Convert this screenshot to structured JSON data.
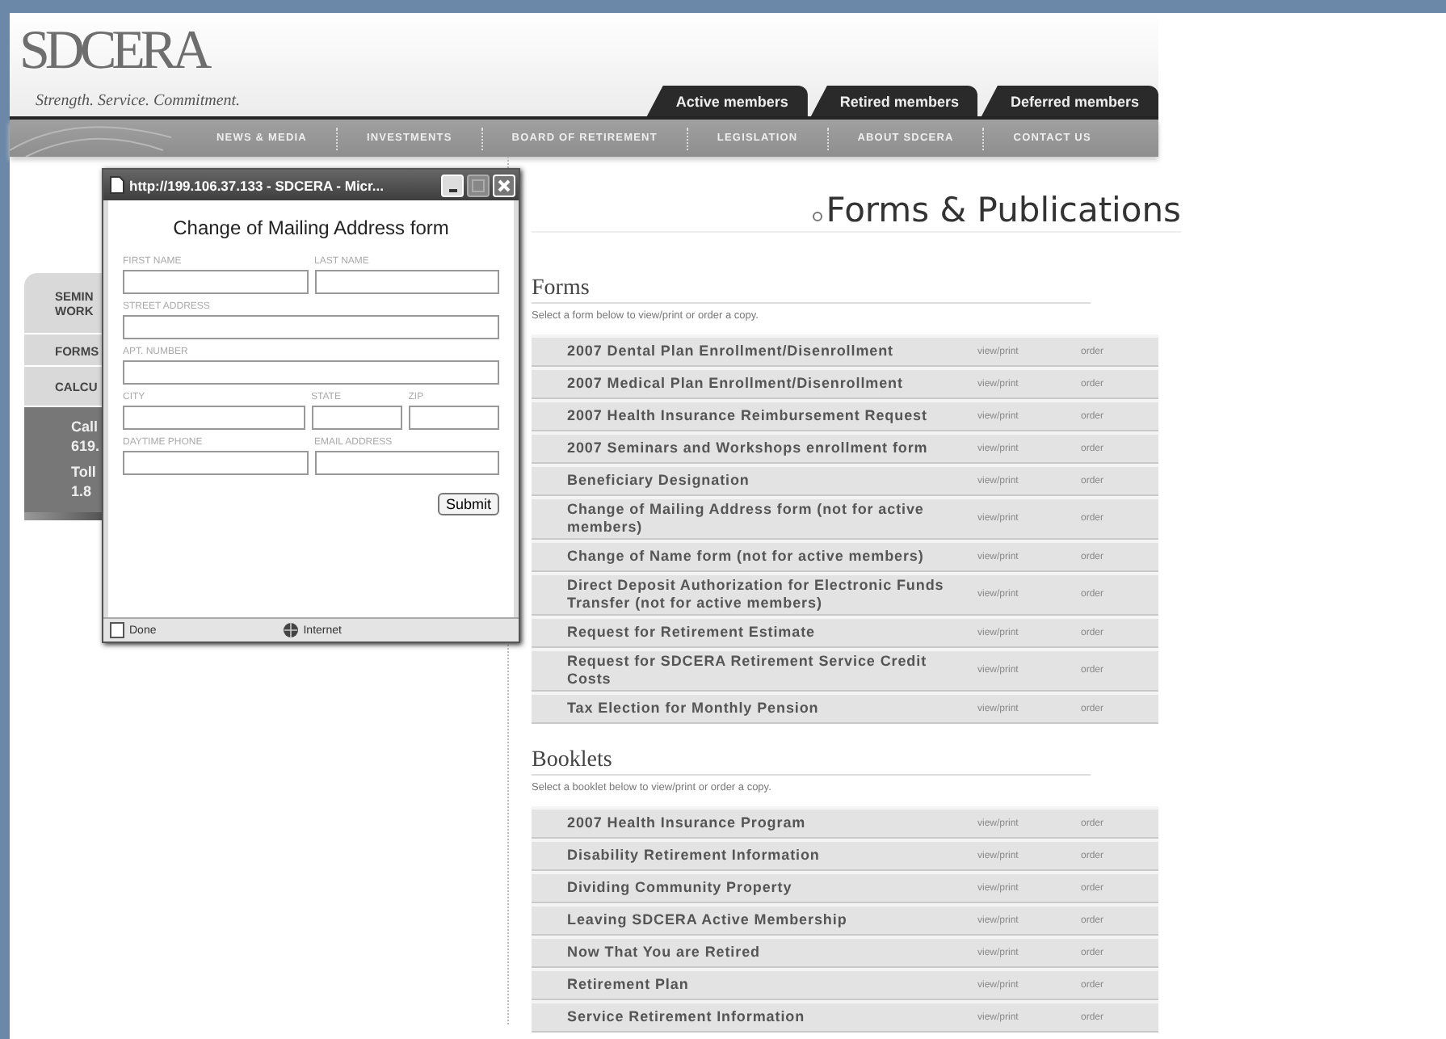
{
  "site": {
    "logo": "SDCERA",
    "tagline": "Strength. Service. Commitment.",
    "member_tabs": [
      "Active members",
      "Retired members",
      "Deferred members"
    ],
    "nav": [
      "NEWS & MEDIA",
      "INVESTMENTS",
      "BOARD OF RETIREMENT",
      "LEGISLATION",
      "ABOUT SDCERA",
      "CONTACT US"
    ]
  },
  "sidebar": {
    "items": [
      [
        "SEMIN",
        "WORK"
      ],
      [
        "FORMS"
      ],
      [
        "CALCU"
      ]
    ],
    "contact": [
      "Call",
      "619.",
      "Toll",
      "1.8"
    ]
  },
  "page_title": "Forms & Publications",
  "sections": [
    {
      "heading": "Forms",
      "description": "Select a form below to view/print or order a copy.",
      "rows": [
        {
          "title": "2007 Dental Plan Enrollment/Disenrollment",
          "view": "view/print",
          "order": "order"
        },
        {
          "title": "2007 Medical Plan Enrollment/Disenrollment",
          "view": "view/print",
          "order": "order"
        },
        {
          "title": "2007 Health Insurance Reimbursement Request",
          "view": "view/print",
          "order": "order"
        },
        {
          "title": "2007 Seminars and Workshops enrollment form",
          "view": "view/print",
          "order": "order"
        },
        {
          "title": "Beneficiary Designation",
          "view": "view/print",
          "order": "order"
        },
        {
          "title": "Change of Mailing Address form (not for active members)",
          "view": "view/print",
          "order": "order"
        },
        {
          "title": "Change of Name form (not for active members)",
          "view": "view/print",
          "order": "order"
        },
        {
          "title": "Direct Deposit Authorization for Electronic Funds Transfer (not for active members)",
          "view": "view/print",
          "order": "order"
        },
        {
          "title": "Request for Retirement Estimate",
          "view": "view/print",
          "order": "order"
        },
        {
          "title": "Request for SDCERA Retirement Service Credit Costs",
          "view": "view/print",
          "order": "order"
        },
        {
          "title": "Tax Election for Monthly Pension",
          "view": "view/print",
          "order": "order"
        }
      ]
    },
    {
      "heading": "Booklets",
      "description": "Select a booklet below to view/print or order a copy.",
      "rows": [
        {
          "title": "2007 Health Insurance Program",
          "view": "view/print",
          "order": "order"
        },
        {
          "title": "Disability Retirement Information",
          "view": "view/print",
          "order": "order"
        },
        {
          "title": "Dividing Community Property",
          "view": "view/print",
          "order": "order"
        },
        {
          "title": "Leaving SDCERA Active Membership",
          "view": "view/print",
          "order": "order"
        },
        {
          "title": "Now That You are Retired",
          "view": "view/print",
          "order": "order"
        },
        {
          "title": "Retirement Plan",
          "view": "view/print",
          "order": "order"
        },
        {
          "title": "Service Retirement Information",
          "view": "view/print",
          "order": "order"
        }
      ]
    }
  ],
  "popup": {
    "title": "http://199.106.37.133 - SDCERA - Micr...",
    "heading": "Change of Mailing Address form",
    "rows": [
      [
        {
          "label": "FIRST NAME"
        },
        {
          "label": "LAST NAME"
        }
      ],
      [
        {
          "label": "STREET ADDRESS"
        }
      ],
      [
        {
          "label": "APT. NUMBER"
        }
      ],
      [
        {
          "label": "CITY"
        },
        {
          "label": "STATE"
        },
        {
          "label": "ZIP"
        }
      ],
      [
        {
          "label": "DAYTIME PHONE"
        },
        {
          "label": "EMAIL ADDRESS"
        }
      ]
    ],
    "submit": "Submit",
    "status": "Done",
    "zone": "Internet"
  }
}
